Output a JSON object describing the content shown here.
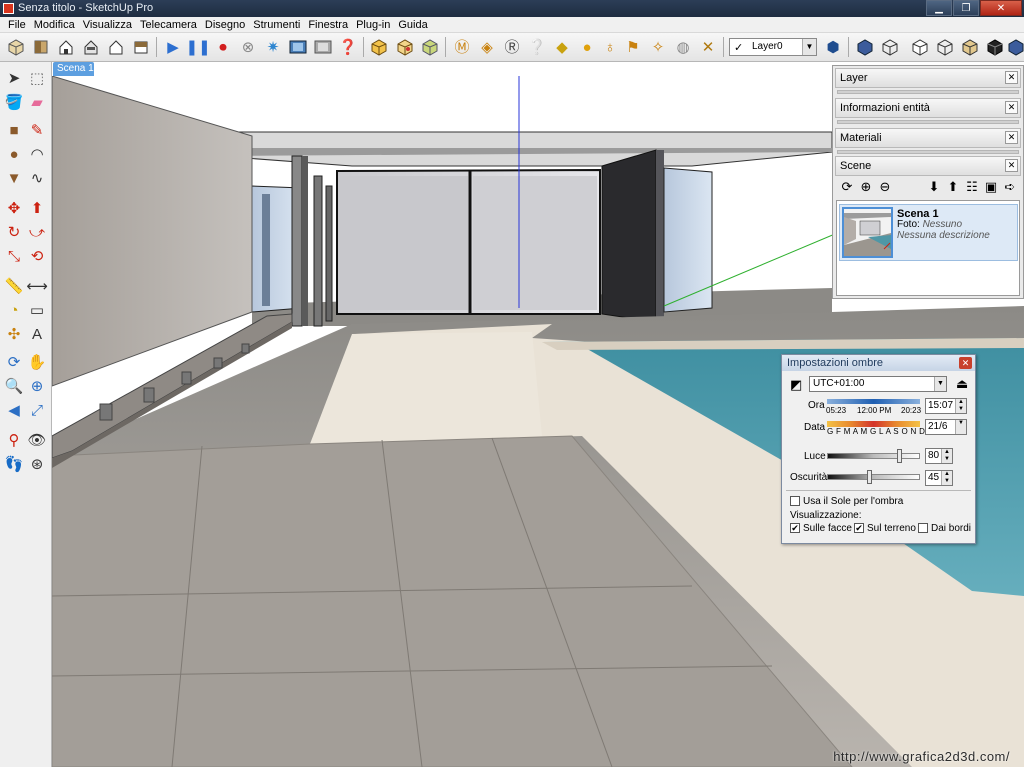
{
  "window": {
    "title": "Senza titolo - SketchUp Pro",
    "min": "0",
    "max": "1",
    "close": "r"
  },
  "menu": [
    "File",
    "Modifica",
    "Visualizza",
    "Telecamera",
    "Disegno",
    "Strumenti",
    "Finestra",
    "Plug-in",
    "Guida"
  ],
  "toolbar": {
    "layer_value": "Layer0"
  },
  "tabs": {
    "active": "Scena 1"
  },
  "trays": {
    "layer": "Layer",
    "entity_info": "Informazioni entità",
    "materials": "Materiali",
    "scenes": "Scene"
  },
  "scene_item": {
    "name": "Scena 1",
    "foto_label": "Foto:",
    "foto_value": "Nessuno",
    "description": "Nessuna descrizione"
  },
  "shadows": {
    "title": "Impostazioni ombre",
    "timezone": "UTC+01:00",
    "time_label": "Ora",
    "time_start": "05:23",
    "time_mid": "12:00 PM",
    "time_end": "20:23",
    "time_value": "15:07",
    "date_label": "Data",
    "months": "G F M A M G L A S O N D",
    "date_value": "21/6",
    "light_label": "Luce",
    "light_value": "80",
    "light_level": 0.8,
    "dark_label": "Oscurità",
    "dark_value": "45",
    "dark_level": 0.45,
    "use_sun_label": "Usa il Sole per l'ombra",
    "display_label": "Visualizzazione:",
    "on_faces_label": "Sulle facce",
    "on_ground_label": "Sul terreno",
    "from_edges_label": "Dai bordi"
  },
  "watermark": "http://www.grafica2d3d.com/",
  "colors": {
    "title_bar": "#2c3e57",
    "tab_active": "#5d9fe0",
    "pool": "#4f97a6"
  }
}
